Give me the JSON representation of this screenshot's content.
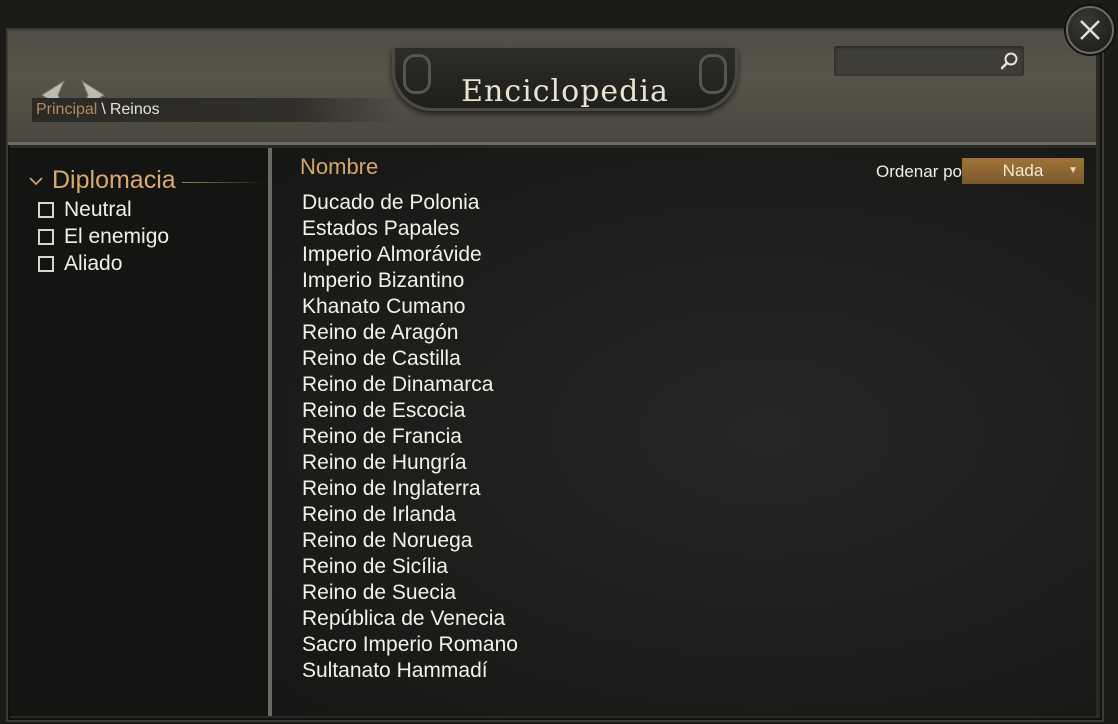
{
  "window": {
    "title": "Enciclopedia"
  },
  "breadcrumb": {
    "items": [
      "Principal",
      "Reinos"
    ],
    "separator": "\\"
  },
  "search": {
    "placeholder": "",
    "value": ""
  },
  "sidebar": {
    "group_title": "Diplomacia",
    "filters": [
      {
        "label": "Neutral",
        "checked": false
      },
      {
        "label": "El enemigo",
        "checked": false
      },
      {
        "label": "Aliado",
        "checked": false
      }
    ]
  },
  "list": {
    "column_header": "Nombre",
    "sort_label": "Ordenar por",
    "sort_value": "Nada",
    "items": [
      "Ducado de Polonia",
      "Estados Papales",
      "Imperio Almorávide",
      "Imperio Bizantino",
      "Khanato Cumano",
      "Reino de Aragón",
      "Reino de Castilla",
      "Reino de Dinamarca",
      "Reino de Escocia",
      "Reino de Francia",
      "Reino de Hungría",
      "Reino de Inglaterra",
      "Reino de Irlanda",
      "Reino de Noruega",
      "Reino de Sicília",
      "Reino de Suecia",
      "República de Venecia",
      "Sacro Imperio Romano",
      "Sultanato Hammadí"
    ]
  },
  "colors": {
    "accent_gold": "#d9aa6e",
    "breadcrumb_link": "#b58a5a",
    "sort_button": "#a07438",
    "text": "#f3f1ec"
  },
  "icons": {
    "close": "close-icon",
    "back": "back-arrow-icon",
    "forward": "forward-arrow-icon",
    "search": "search-icon",
    "collapse": "chevron-down-icon"
  }
}
